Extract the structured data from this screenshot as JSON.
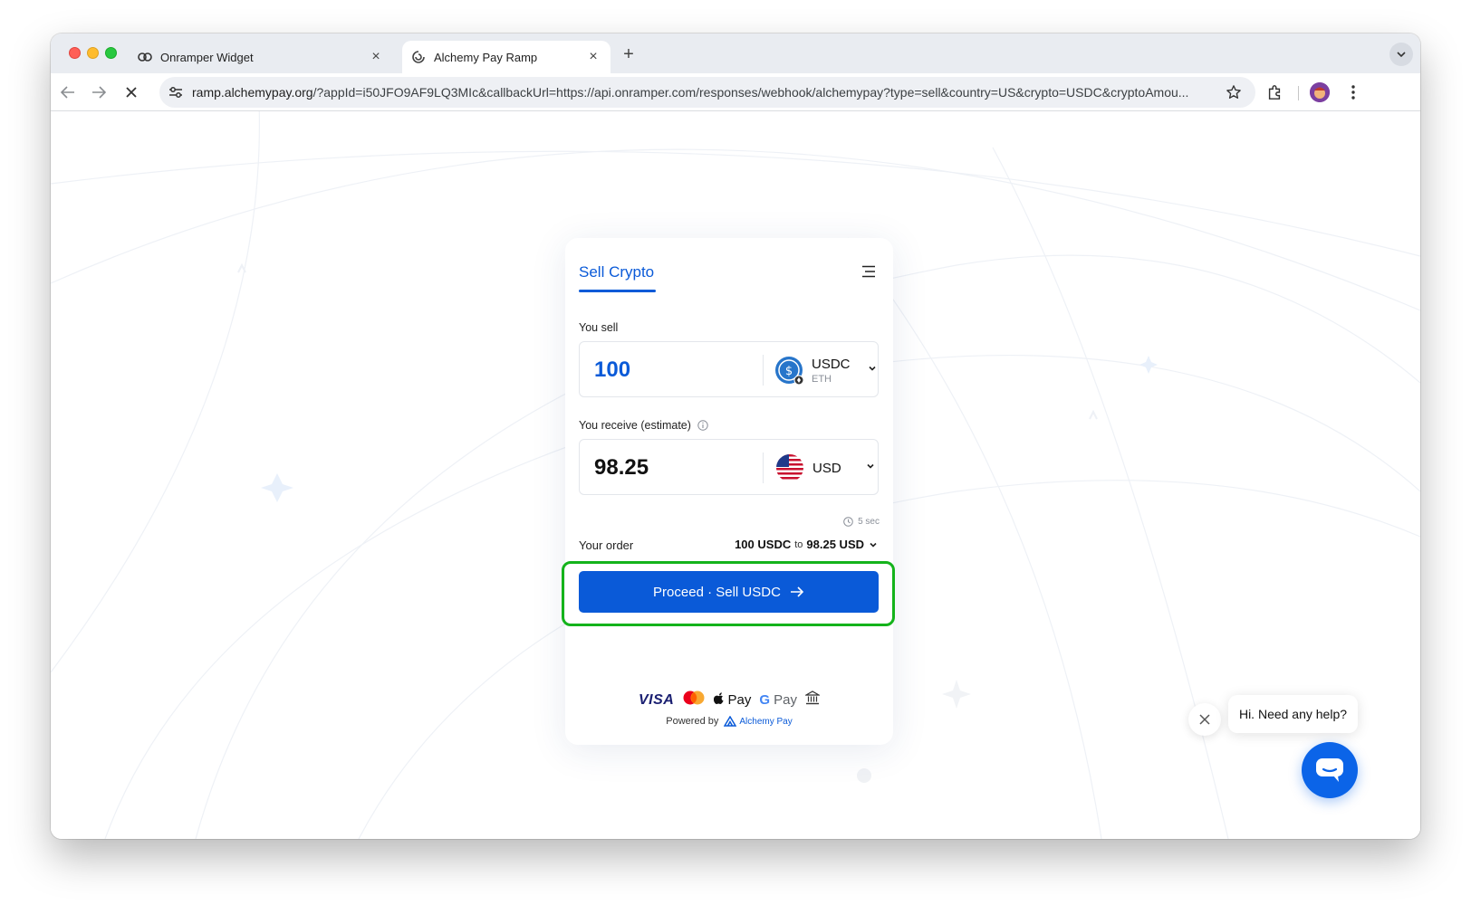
{
  "browser": {
    "tabs": [
      {
        "label": "Onramper Widget",
        "icon": "onramper-favicon",
        "active": false
      },
      {
        "label": "Alchemy Pay Ramp",
        "icon": "alchemypay-favicon",
        "active": true
      }
    ],
    "url_host": "ramp.alchemypay.org",
    "url_rest": "/?appId=i50JFO9AF9LQ3MIc&callbackUrl=https://api.onramper.com/responses/webhook/alchemypay?type=sell&country=US&crypto=USDC&cryptoAmou..."
  },
  "widget": {
    "title": "Sell Crypto",
    "sell_label": "You sell",
    "sell_amount": "100",
    "sell_currency": "USDC",
    "sell_network": "ETH",
    "receive_label": "You receive (estimate)",
    "receive_amount": "98.25",
    "receive_currency": "USD",
    "timer": "5 sec",
    "order_label": "Your order",
    "order_from": "100 USDC",
    "order_to_word": "to",
    "order_to": "98.25 USD",
    "proceed_label": "Proceed · Sell USDC",
    "payments": {
      "visa": "VISA",
      "apple_pay": "Pay",
      "google_pay_g": "G",
      "google_pay": "Pay"
    },
    "powered_by": "Powered by",
    "brand": "Alchemy Pay"
  },
  "chat": {
    "message": "Hi. Need any help?"
  },
  "colors": {
    "accent": "#0a5ad8",
    "highlight": "#14b31b",
    "chat": "#0b64e8"
  }
}
